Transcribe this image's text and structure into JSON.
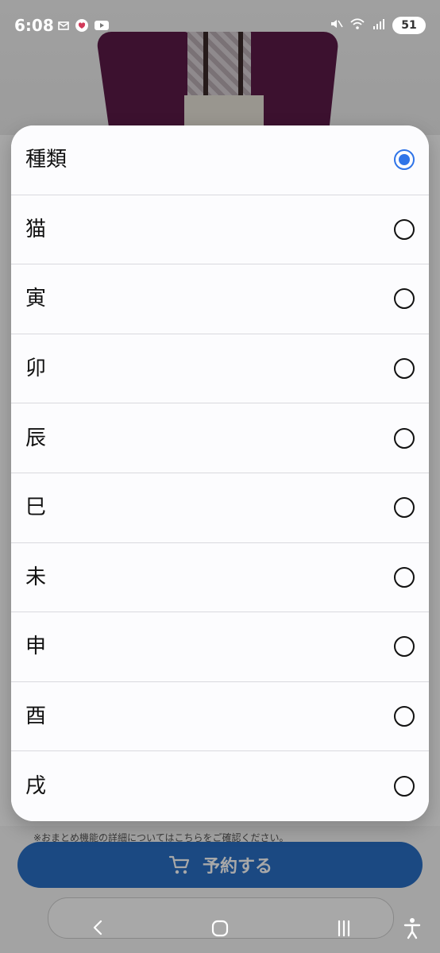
{
  "status_bar": {
    "time": "6:08",
    "battery": "51",
    "left_icons": [
      "mail-icon",
      "heart-app-icon",
      "youtube-icon"
    ],
    "right_icons": [
      "mute-icon",
      "wifi-icon",
      "signal-icon"
    ]
  },
  "modal": {
    "options": [
      {
        "label": "種類",
        "selected": true
      },
      {
        "label": "猫",
        "selected": false
      },
      {
        "label": "寅",
        "selected": false
      },
      {
        "label": "卯",
        "selected": false
      },
      {
        "label": "辰",
        "selected": false
      },
      {
        "label": "巳",
        "selected": false
      },
      {
        "label": "未",
        "selected": false
      },
      {
        "label": "申",
        "selected": false
      },
      {
        "label": "酉",
        "selected": false
      },
      {
        "label": "戌",
        "selected": false
      }
    ]
  },
  "background": {
    "note": "※おまとめ機能の詳細についてはこちらをご確認ください。",
    "reserve_label": "予約する",
    "reserve_icon": "cart-icon"
  },
  "nav_bar": {
    "buttons": [
      "back-icon",
      "home-icon",
      "recents-icon",
      "accessibility-icon"
    ]
  },
  "colors": {
    "accent": "#2f74e8",
    "button": "#2a6fc6",
    "coat": "#5b1a48",
    "scrim": "rgba(0,0,0,0.34)"
  }
}
